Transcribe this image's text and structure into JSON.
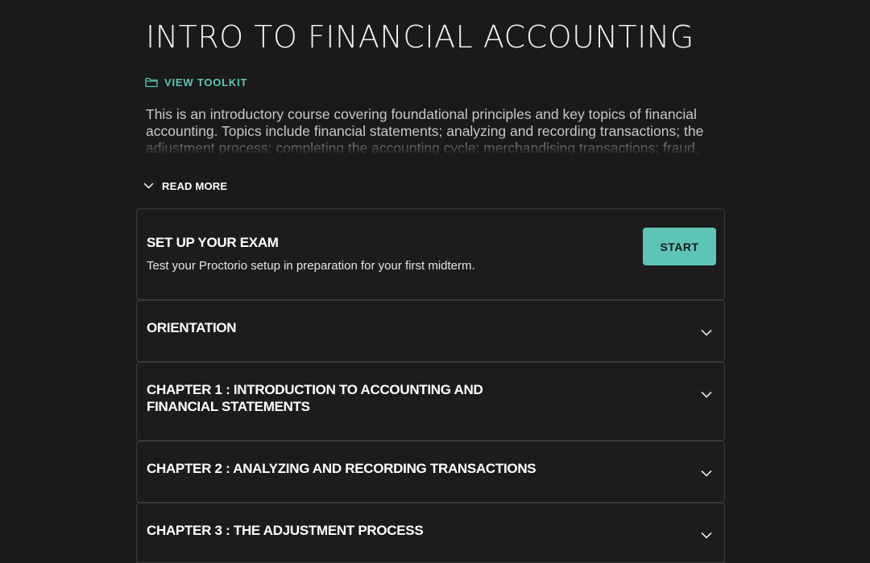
{
  "course": {
    "title": "INTRO TO FINANCIAL ACCOUNTING",
    "toolkit_label": "VIEW TOOLKIT",
    "toolkit_icon": "folder-icon",
    "description": "This is an introductory course covering foundational principles and key topics of financial accounting. Topics include financial statements; analyzing and recording transactions; the adjustment process; completing the accounting cycle; merchandising transactions; fraud,",
    "read_more_label": "READ MORE",
    "read_more_icon": "chevron-down-icon"
  },
  "exam_card": {
    "title": "SET UP YOUR EXAM",
    "subtitle": "Test your Proctorio setup in preparation for your first midterm.",
    "button_label": "START"
  },
  "sections": [
    {
      "title": "ORIENTATION",
      "icon": "chevron-down-icon"
    },
    {
      "title_line1": "CHAPTER 1 : INTRODUCTION TO ACCOUNTING AND",
      "title_line2": "FINANCIAL STATEMENTS",
      "icon": "chevron-down-icon"
    },
    {
      "title": "CHAPTER 2 : ANALYZING AND RECORDING TRANSACTIONS",
      "icon": "chevron-down-icon"
    },
    {
      "title": "CHAPTER 3 : THE ADJUSTMENT PROCESS",
      "icon": "chevron-down-icon"
    }
  ],
  "colors": {
    "background": "#1a1a1b",
    "accent": "#5ec4b6",
    "card_border": "#3a3a3c"
  }
}
